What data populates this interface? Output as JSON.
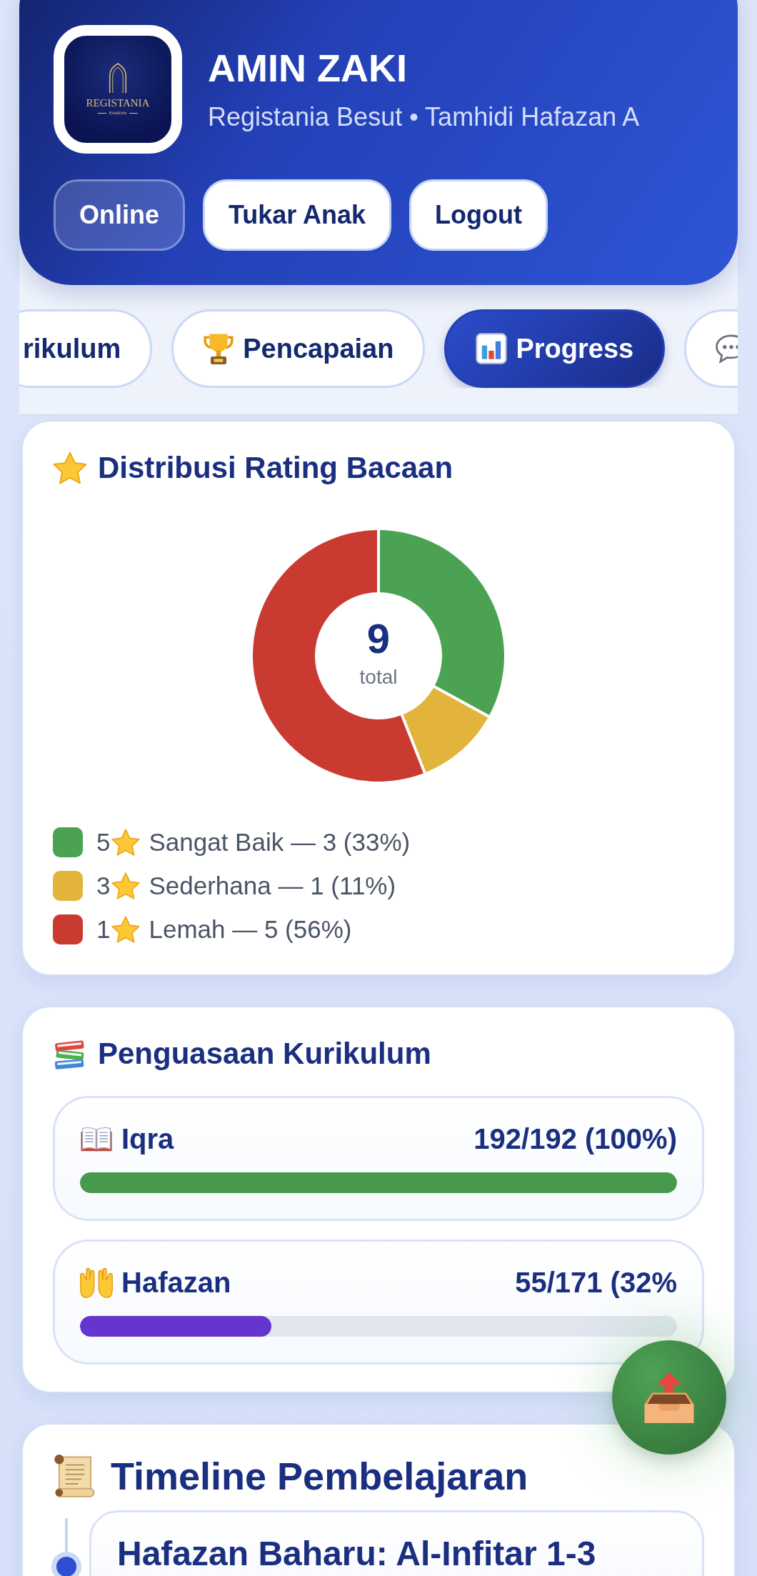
{
  "header": {
    "logo": {
      "title": "REGISTANIA",
      "subtitle": "EduKids"
    },
    "name": "AMIN ZAKI",
    "subtitle": "Registania Besut • Tamhidi Hafazan A",
    "status": "Online",
    "buttons": [
      "Tukar Anak",
      "Logout"
    ]
  },
  "tabs": [
    {
      "label": "rikulum",
      "selected": false
    },
    {
      "label": "Pencapaian",
      "selected": false
    },
    {
      "label": "Progress",
      "selected": true
    },
    {
      "selected": false
    }
  ],
  "rating_card": {
    "title": "Distribusi Rating Bacaan",
    "chart_data": {
      "type": "donut",
      "values": [
        33,
        11,
        56
      ]
    },
    "center_value": "9",
    "center_label": "total",
    "legend": [
      {
        "rating": "5",
        "label": "Sangat Baik — 3 (33%)",
        "color": "#4ca253"
      },
      {
        "rating": "3",
        "label": "Sederhana — 1 (11%)",
        "color": "#e2b43c"
      },
      {
        "rating": "1",
        "label": "Lemah — 5 (56%)",
        "color": "#c93a31"
      }
    ]
  },
  "curriculum_card": {
    "title": "Penguasaan Kurikulum",
    "items": [
      {
        "name": "Iqra",
        "value": "192/192 (100%)",
        "level": 1,
        "color": "#46994d"
      },
      {
        "name": "Hafazan",
        "value": "55/171 (32%",
        "level": 0.32,
        "color": "#6634cf"
      }
    ]
  },
  "timeline_card": {
    "title": "Timeline Pembelajaran",
    "items": [
      {
        "title": "Hafazan Baharu: Al-Infitar 1-3"
      }
    ]
  }
}
